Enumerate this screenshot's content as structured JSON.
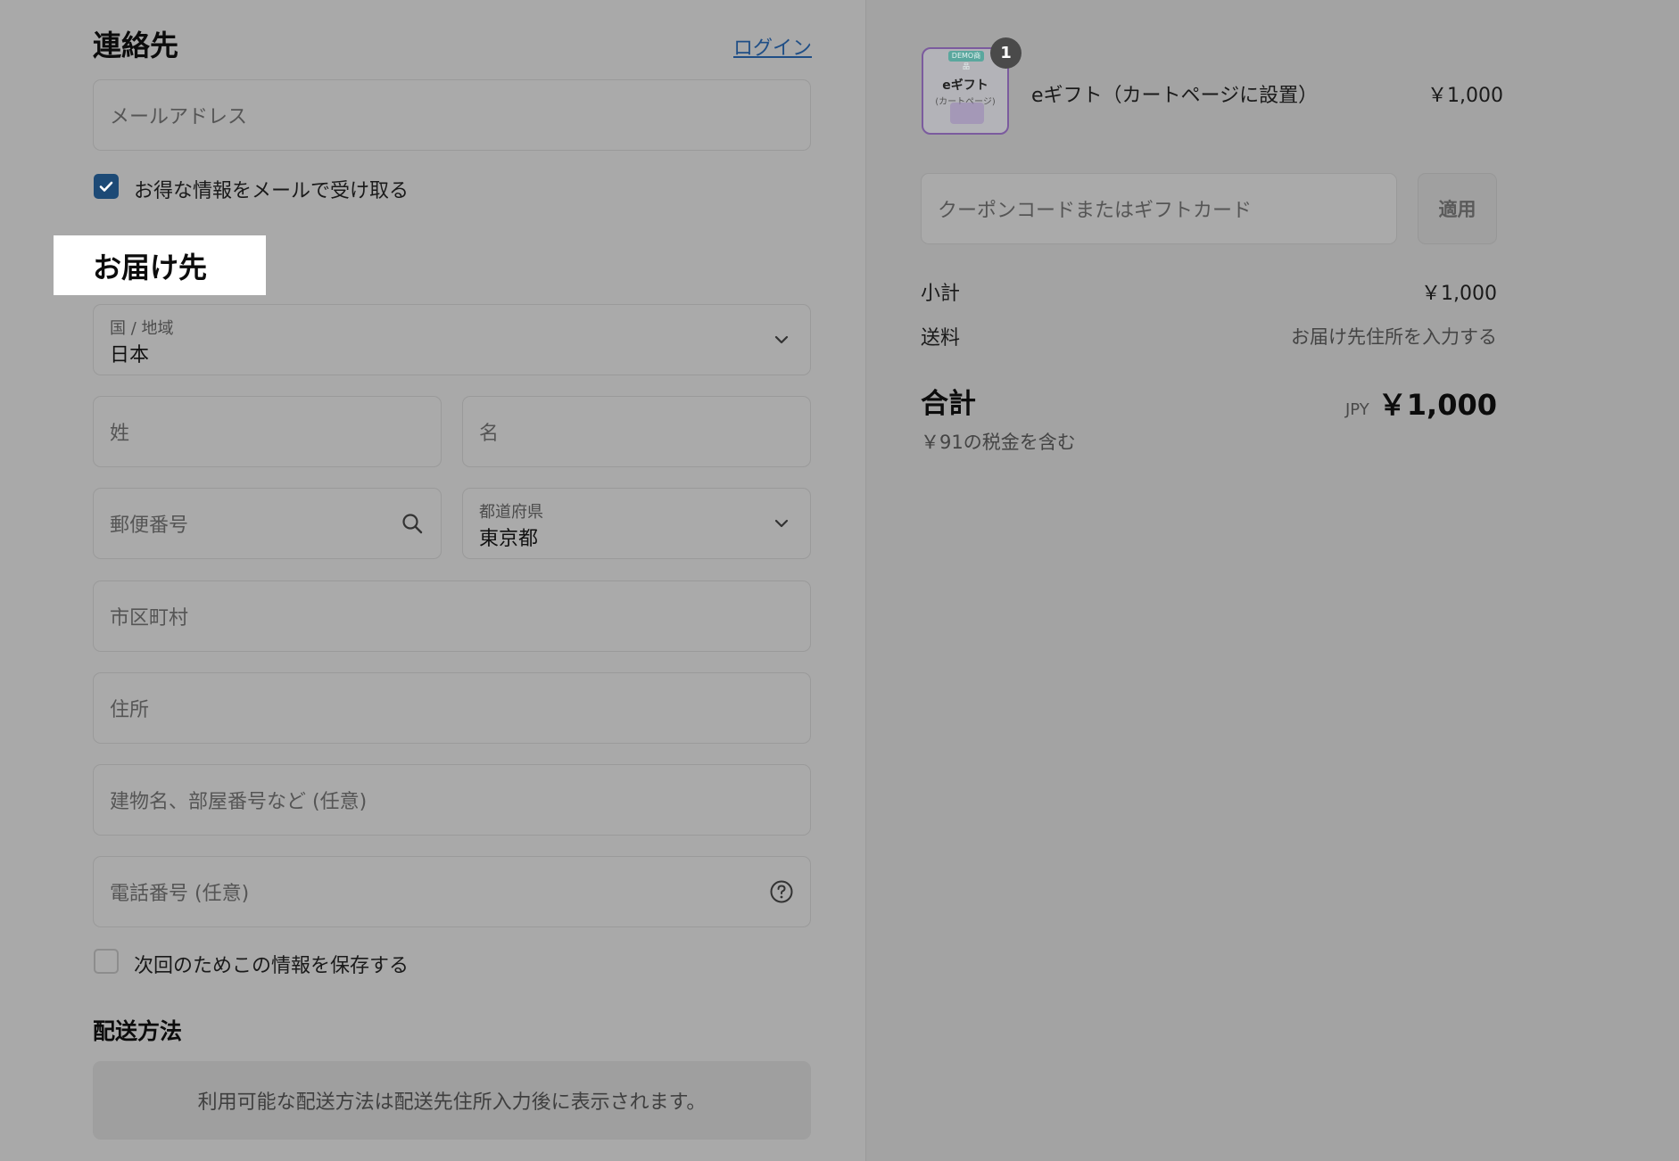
{
  "contact": {
    "title": "連絡先",
    "login_link": "ログイン",
    "email_placeholder": "メールアドレス",
    "newsletter_label": "お得な情報をメールで受け取る",
    "newsletter_checked": true
  },
  "delivery": {
    "title": "お届け先",
    "country_label": "国 / 地域",
    "country_value": "日本",
    "last_name_placeholder": "姓",
    "first_name_placeholder": "名",
    "postal_placeholder": "郵便番号",
    "prefecture_label": "都道府県",
    "prefecture_value": "東京都",
    "city_placeholder": "市区町村",
    "address_placeholder": "住所",
    "building_placeholder": "建物名、部屋番号など (任意)",
    "phone_placeholder": "電話番号 (任意)",
    "save_info_label": "次回のためこの情報を保存する",
    "save_info_checked": false
  },
  "shipping": {
    "title": "配送方法",
    "notice": "利用可能な配送方法は配送先住所入力後に表示されます。"
  },
  "summary": {
    "item": {
      "name": "eギフト（カートページに設置）",
      "price": "￥1,000",
      "quantity": "1",
      "thumb_tag": "DEMO商品",
      "thumb_title": "eギフト",
      "thumb_sub": "(カートページ)"
    },
    "coupon_placeholder": "クーポンコードまたはギフトカード",
    "apply_label": "適用",
    "subtotal_label": "小計",
    "subtotal_value": "￥1,000",
    "shipping_label": "送料",
    "shipping_value": "お届け先住所を入力する",
    "total_label": "合計",
    "currency": "JPY",
    "total_value": "￥1,000",
    "tax_note": "￥91の税金を含む"
  },
  "colors": {
    "accent": "#1d4a76",
    "overlay_bg": "#a9a9a9",
    "highlight": "#ffffff"
  }
}
